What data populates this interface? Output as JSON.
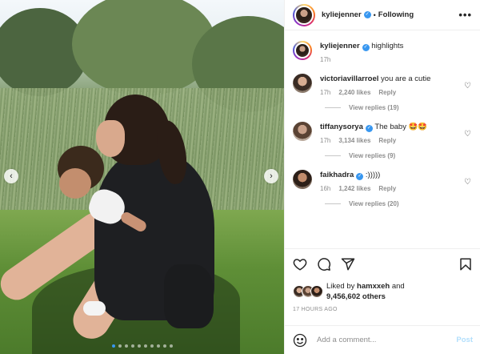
{
  "post": {
    "author": "kyliejenner",
    "separator": "•",
    "follow_state": "Following",
    "more_label": "•••",
    "caption": "highlights",
    "caption_time": "17h",
    "carousel": {
      "total": 10,
      "active": 0
    },
    "nav_prev_glyph": "‹",
    "nav_next_glyph": "›"
  },
  "comments": [
    {
      "user": "victoriavillarroel",
      "verified": false,
      "text": "you are a cutie",
      "time": "17h",
      "likes": "2,240 likes",
      "reply": "Reply",
      "view_replies": "View replies (19)"
    },
    {
      "user": "tiffanysorya",
      "verified": true,
      "text": "The baby 🤩🤩",
      "time": "17h",
      "likes": "3,134 likes",
      "reply": "Reply",
      "view_replies": "View replies (9)"
    },
    {
      "user": "faikhadra",
      "verified": true,
      "text": ":)))))",
      "time": "16h",
      "likes": "1,242 likes",
      "reply": "Reply",
      "view_replies": "View replies (20)"
    }
  ],
  "likes": {
    "prefix": "Liked by",
    "user": "hamxxeh",
    "and": "and",
    "count": "9,456,602 others"
  },
  "time_ago": "17 HOURS AGO",
  "add_comment": {
    "placeholder": "Add a comment...",
    "post_label": "Post"
  },
  "icons": [
    "heart-icon",
    "comment-icon",
    "share-icon",
    "bookmark-icon",
    "emoji-icon",
    "verified-icon",
    "more-icon"
  ],
  "colors": {
    "verified": "#3897f0",
    "post_disabled": "#b2dffc",
    "muted": "#8e8e8e"
  }
}
